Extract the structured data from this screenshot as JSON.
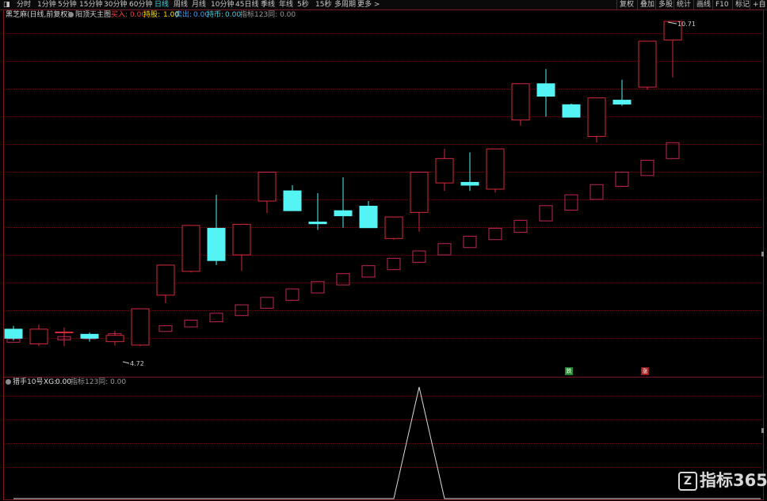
{
  "toolbar": {
    "periods": [
      {
        "label": "分时",
        "active": false
      },
      {
        "label": "1分钟",
        "active": false
      },
      {
        "label": "5分钟",
        "active": false
      },
      {
        "label": "15分钟",
        "active": false
      },
      {
        "label": "30分钟",
        "active": false
      },
      {
        "label": "60分钟",
        "active": false
      },
      {
        "label": "日线",
        "active": true
      },
      {
        "label": "周线",
        "active": false
      },
      {
        "label": "月线",
        "active": false
      },
      {
        "label": "10分钟",
        "active": false
      },
      {
        "label": "45日线",
        "active": false
      },
      {
        "label": "季线",
        "active": false
      },
      {
        "label": "年线",
        "active": false
      },
      {
        "label": "5秒",
        "active": false
      },
      {
        "label": "15秒",
        "active": false
      },
      {
        "label": "多周期",
        "active": false
      },
      {
        "label": "更多 >",
        "active": false
      }
    ],
    "right_buttons": [
      "复权",
      "叠加",
      "多股",
      "统计",
      "画线",
      "F10",
      "标记",
      "+自"
    ]
  },
  "main_panel": {
    "stock_name": "黑芝麻(日线,前复权)",
    "indicator_name": "阳顶天主图",
    "fields": [
      {
        "label": "买入:",
        "value": "0.00",
        "color": "#ff3b3b"
      },
      {
        "label": "持股:",
        "value": "1.00",
        "color": "#ffe000"
      },
      {
        "label": "卖出:",
        "value": "0.00",
        "color": "#3aa3ff"
      },
      {
        "label": "持币:",
        "value": "0.00",
        "color": "#3fd3e4"
      }
    ],
    "extra": "指标123同: 0.00",
    "high_label": "10.71",
    "low_label": "4.72"
  },
  "sub_panel": {
    "indicator_name": "猎手10号",
    "fields": [
      {
        "label": "XG:",
        "value": "0.00",
        "color": "#e6e6e6"
      }
    ],
    "extra": "指标123同: 0.00"
  },
  "tags": [
    {
      "text": "跌",
      "color": "#1f8a2e"
    },
    {
      "text": "涨",
      "color": "#a01c1c"
    }
  ],
  "watermark": "指标365",
  "colors": {
    "up": "#d8283a",
    "down": "#55f4f4",
    "lower_box": "#c0265a",
    "signal": "#dcdcdc",
    "grid": "#5a0d14"
  },
  "chart_data": [
    {
      "type": "candlestick",
      "series": [
        {
          "name": "K线",
          "values": [
            {
              "o": 5.28,
              "c": 5.12,
              "h": 5.34,
              "l": 5.08
            },
            {
              "o": 5.02,
              "c": 5.28,
              "h": 5.36,
              "l": 4.98
            },
            {
              "o": 5.23,
              "c": 5.23,
              "h": 5.31,
              "l": 4.98
            },
            {
              "o": 5.19,
              "c": 5.12,
              "h": 5.22,
              "l": 5.06
            },
            {
              "o": 5.06,
              "c": 5.17,
              "h": 5.25,
              "l": 4.99
            },
            {
              "o": 5.0,
              "c": 5.64,
              "h": 5.64,
              "l": 4.98
            },
            {
              "o": 5.88,
              "c": 6.41,
              "h": 6.41,
              "l": 5.74
            },
            {
              "o": 6.3,
              "c": 7.11,
              "h": 7.11,
              "l": 6.28
            },
            {
              "o": 7.06,
              "c": 6.49,
              "h": 7.65,
              "l": 6.41
            },
            {
              "o": 6.59,
              "c": 7.13,
              "h": 7.13,
              "l": 6.31
            },
            {
              "o": 7.54,
              "c": 8.05,
              "h": 8.05,
              "l": 7.33
            },
            {
              "o": 7.72,
              "c": 7.37,
              "h": 7.82,
              "l": 7.37
            },
            {
              "o": 7.17,
              "c": 7.14,
              "h": 7.68,
              "l": 7.03
            },
            {
              "o": 7.37,
              "c": 7.28,
              "h": 7.96,
              "l": 7.07
            },
            {
              "o": 7.45,
              "c": 7.07,
              "h": 7.54,
              "l": 7.07
            },
            {
              "o": 6.88,
              "c": 7.26,
              "h": 7.26,
              "l": 6.86
            },
            {
              "o": 7.34,
              "c": 8.05,
              "h": 8.05,
              "l": 7.0
            },
            {
              "o": 7.86,
              "c": 8.29,
              "h": 8.46,
              "l": 7.72
            },
            {
              "o": 7.87,
              "c": 7.82,
              "h": 8.4,
              "l": 7.72
            },
            {
              "o": 7.75,
              "c": 8.46,
              "h": 8.46,
              "l": 7.69
            },
            {
              "o": 8.97,
              "c": 9.61,
              "h": 9.61,
              "l": 8.87
            },
            {
              "o": 9.61,
              "c": 9.39,
              "h": 9.87,
              "l": 9.03
            },
            {
              "o": 9.24,
              "c": 9.02,
              "h": 9.26,
              "l": 9.02
            },
            {
              "o": 8.68,
              "c": 9.36,
              "h": 9.36,
              "l": 8.57
            },
            {
              "o": 9.32,
              "c": 9.25,
              "h": 9.68,
              "l": 9.22
            },
            {
              "o": 9.55,
              "c": 10.36,
              "h": 10.36,
              "l": 9.5
            },
            {
              "o": 10.38,
              "c": 10.71,
              "h": 10.71,
              "l": 9.72
            }
          ]
        },
        {
          "name": "下轨",
          "values": [
            [
              5.05,
              5.11
            ],
            [
              5.07,
              5.13
            ],
            [
              5.09,
              5.15
            ],
            [
              5.11,
              5.17
            ],
            [
              5.14,
              5.2
            ],
            [
              5.17,
              5.24
            ],
            [
              5.24,
              5.34
            ],
            [
              5.32,
              5.44
            ],
            [
              5.41,
              5.56
            ],
            [
              5.52,
              5.71
            ],
            [
              5.65,
              5.84
            ],
            [
              5.79,
              5.99
            ],
            [
              5.92,
              6.12
            ],
            [
              6.06,
              6.26
            ],
            [
              6.2,
              6.4
            ],
            [
              6.33,
              6.53
            ],
            [
              6.46,
              6.66
            ],
            [
              6.59,
              6.79
            ],
            [
              6.72,
              6.92
            ],
            [
              6.86,
              7.06
            ],
            [
              6.99,
              7.2
            ],
            [
              7.19,
              7.46
            ],
            [
              7.38,
              7.65
            ],
            [
              7.57,
              7.83
            ],
            [
              7.8,
              8.05
            ],
            [
              7.99,
              8.26
            ],
            [
              8.29,
              8.57
            ]
          ]
        }
      ],
      "ylim": [
        4.72,
        10.71
      ],
      "low_label": "4.72",
      "high_label": "10.71"
    },
    {
      "type": "line",
      "series": [
        {
          "name": "XG",
          "values": [
            0,
            0,
            0,
            0,
            0,
            0,
            0,
            0,
            0,
            0,
            0,
            0,
            0,
            0,
            0,
            0,
            1,
            0,
            0,
            0,
            0,
            0,
            0,
            0,
            0,
            0,
            0
          ]
        }
      ],
      "ylim": [
        0,
        1
      ]
    }
  ]
}
